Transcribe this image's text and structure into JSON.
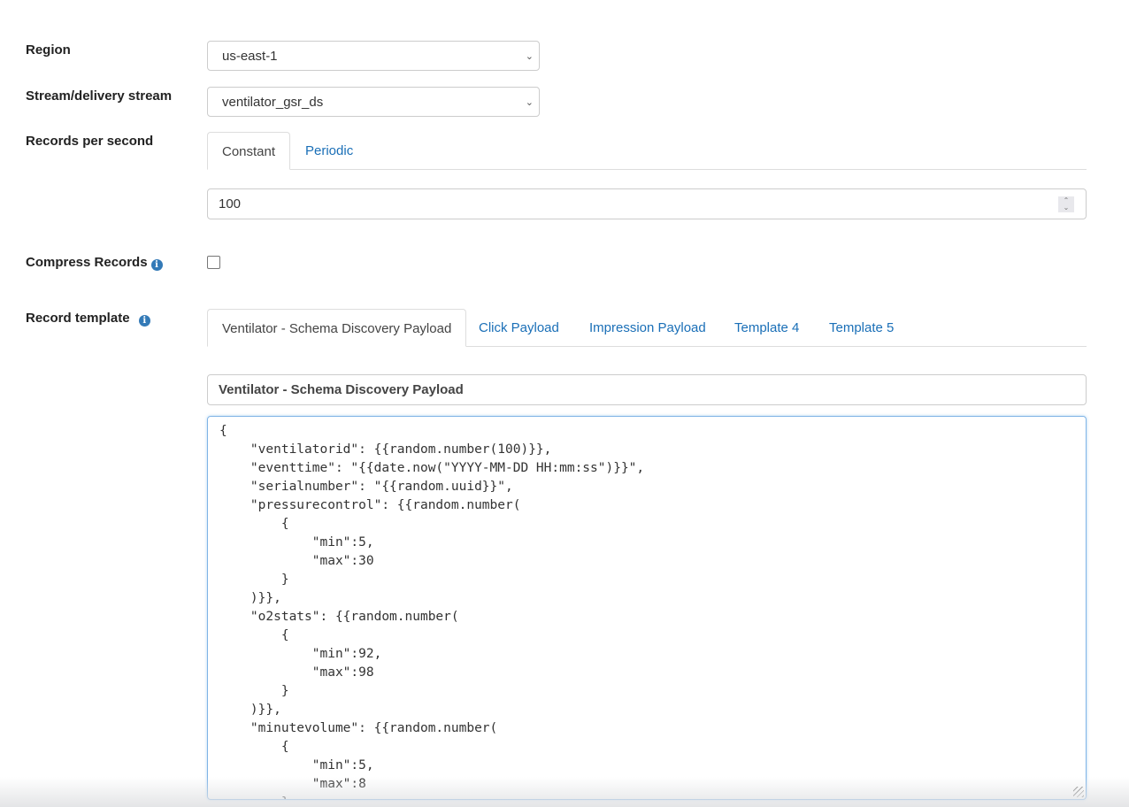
{
  "region": {
    "label": "Region",
    "value": "us-east-1"
  },
  "stream": {
    "label": "Stream/delivery stream",
    "value": "ventilator_gsr_ds"
  },
  "records_per_second": {
    "label": "Records per second",
    "tabs": [
      {
        "label": "Constant",
        "active": true
      },
      {
        "label": "Periodic",
        "active": false
      }
    ],
    "value": "100"
  },
  "compress": {
    "label": "Compress Records",
    "info_icon": "info-icon",
    "checked": false
  },
  "record_template": {
    "label": "Record template",
    "info_icon": "info-icon",
    "tabs": [
      {
        "label": "Ventilator - Schema Discovery Payload",
        "active": true
      },
      {
        "label": "Click Payload",
        "active": false
      },
      {
        "label": "Impression Payload",
        "active": false
      },
      {
        "label": "Template 4",
        "active": false
      },
      {
        "label": "Template 5",
        "active": false
      }
    ],
    "name": "Ventilator - Schema Discovery Payload",
    "body": "{\n    \"ventilatorid\": {{random.number(100)}},\n    \"eventtime\": \"{{date.now(\"YYYY-MM-DD HH:mm:ss\")}}\",\n    \"serialnumber\": \"{{random.uuid}}\",\n    \"pressurecontrol\": {{random.number(\n        {\n            \"min\":5,\n            \"max\":30\n        }\n    )}},\n    \"o2stats\": {{random.number(\n        {\n            \"min\":92,\n            \"max\":98\n        }\n    )}},\n    \"minutevolume\": {{random.number(\n        {\n            \"min\":5,\n            \"max\":8\n        }"
  },
  "colors": {
    "link": "#1a6fb7",
    "info": "#337ab7",
    "focus_border": "#80b4e6"
  }
}
